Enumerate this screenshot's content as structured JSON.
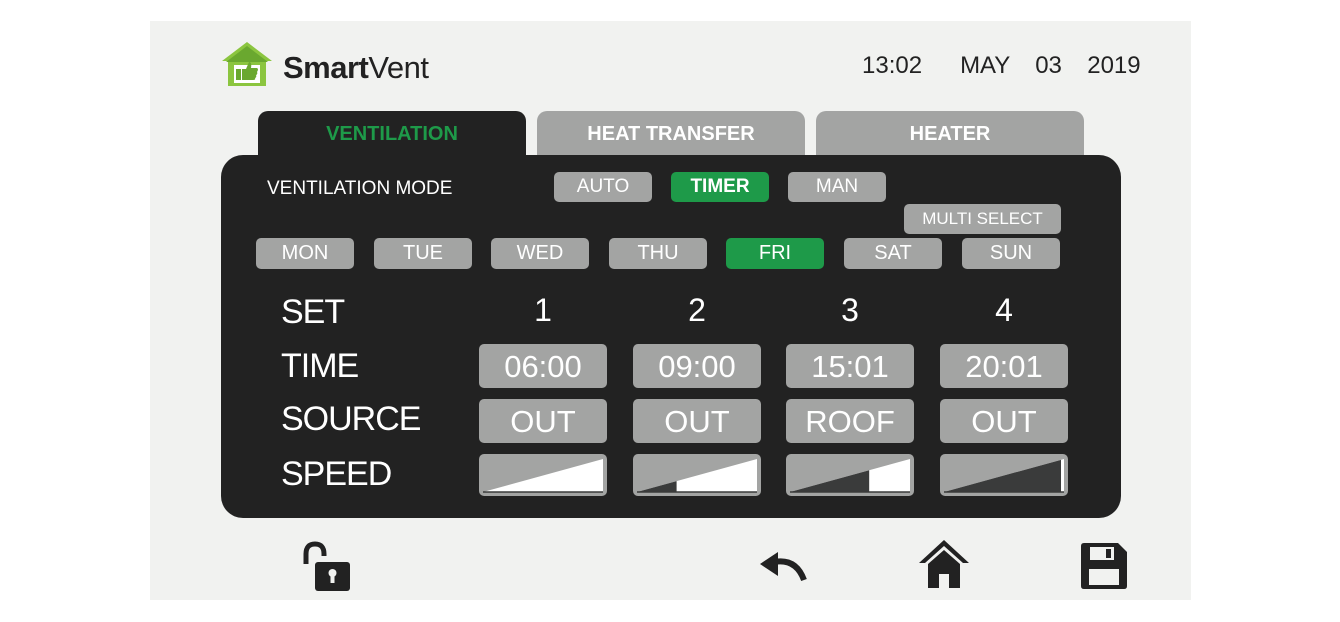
{
  "header": {
    "logo_brand_bold": "Smart",
    "logo_brand_light": "Vent",
    "datetime": "13:02   MAY  03  2019"
  },
  "tabs": [
    {
      "label": "VENTILATION",
      "active": true
    },
    {
      "label": "HEAT TRANSFER",
      "active": false
    },
    {
      "label": "HEATER",
      "active": false
    }
  ],
  "ventilation": {
    "mode_label": "VENTILATION MODE",
    "modes": [
      {
        "label": "AUTO",
        "active": false
      },
      {
        "label": "TIMER",
        "active": true
      },
      {
        "label": "MAN",
        "active": false
      }
    ],
    "multi_select_label": "MULTI SELECT",
    "days": [
      {
        "label": "MON",
        "active": false
      },
      {
        "label": "TUE",
        "active": false
      },
      {
        "label": "WED",
        "active": false
      },
      {
        "label": "THU",
        "active": false
      },
      {
        "label": "FRI",
        "active": true
      },
      {
        "label": "SAT",
        "active": false
      },
      {
        "label": "SUN",
        "active": false
      }
    ],
    "row_labels": {
      "set": "SET",
      "time": "TIME",
      "source": "SOURCE",
      "speed": "SPEED"
    },
    "sets": [
      {
        "number": "1",
        "time": "06:00",
        "source": "OUT",
        "speed_level": 0.0
      },
      {
        "number": "2",
        "time": "09:00",
        "source": "OUT",
        "speed_level": 0.33
      },
      {
        "number": "3",
        "time": "15:01",
        "source": "ROOF",
        "speed_level": 0.66
      },
      {
        "number": "4",
        "time": "20:01",
        "source": "OUT",
        "speed_level": 1.0
      }
    ]
  },
  "footer": {
    "icons": [
      "unlock-icon",
      "undo-icon",
      "home-icon",
      "save-icon"
    ]
  },
  "colors": {
    "accent_green": "#1e9a49",
    "panel_dark": "#222222",
    "button_grey": "#a3a4a3",
    "screen_bg": "#f1f2f0"
  }
}
